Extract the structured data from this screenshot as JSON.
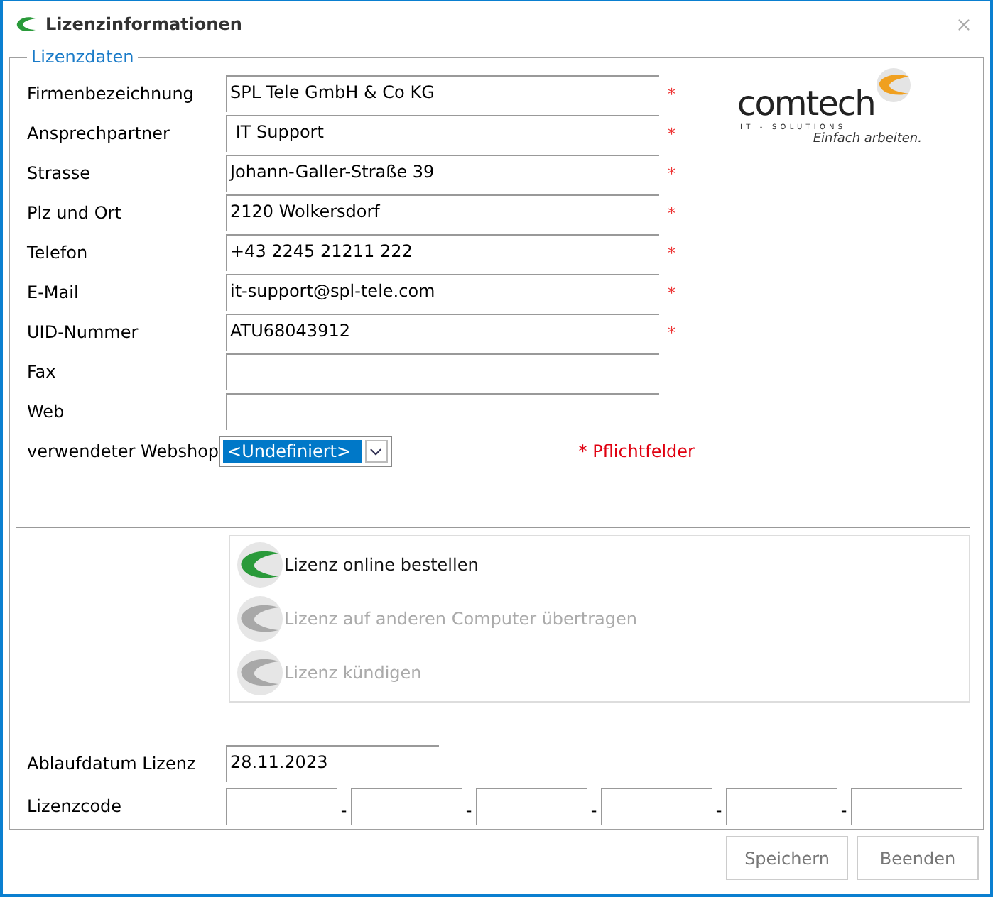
{
  "window": {
    "title": "Lizenzinformationen"
  },
  "group": {
    "title": "Lizenzdaten"
  },
  "logo": {
    "name": "comtech",
    "subtitle": "IT - SOLUTIONS",
    "slogan": "Einfach arbeiten."
  },
  "fields": [
    {
      "label": "Firmenbezeichnung",
      "value": "SPL Tele GmbH & Co KG",
      "required": true
    },
    {
      "label": "Ansprechpartner",
      "value": " IT Support",
      "required": true
    },
    {
      "label": "Strasse",
      "value": "Johann-Galler-Straße 39",
      "required": true
    },
    {
      "label": "Plz und Ort",
      "value": "2120 Wolkersdorf",
      "required": true
    },
    {
      "label": "Telefon",
      "value": "+43 2245 21211 222",
      "required": true
    },
    {
      "label": "E-Mail",
      "value": "it-support@spl-tele.com",
      "required": true
    },
    {
      "label": "UID-Nummer",
      "value": "ATU68043912",
      "required": true
    },
    {
      "label": "Fax",
      "required": false
    },
    {
      "label": "Web",
      "required": false
    }
  ],
  "webshop": {
    "label": "verwendeter Webshop",
    "value": "<Undefiniert>",
    "selected": true
  },
  "required_note": {
    "mark": "*",
    "text": "Pflichtfelder"
  },
  "required_mark": "*",
  "actions": [
    {
      "label": "Lizenz online bestellen",
      "disabled": false
    },
    {
      "label": "Lizenz auf anderen Computer übertragen",
      "disabled": true
    },
    {
      "label": "Lizenz kündigen",
      "disabled": true
    }
  ],
  "expiry": {
    "label": "Ablaufdatum Lizenz",
    "value": "28.11.2023"
  },
  "license_code": {
    "label": "Lizenzcode",
    "separator": "-"
  },
  "buttons": [
    "Speichern",
    "Beenden"
  ]
}
